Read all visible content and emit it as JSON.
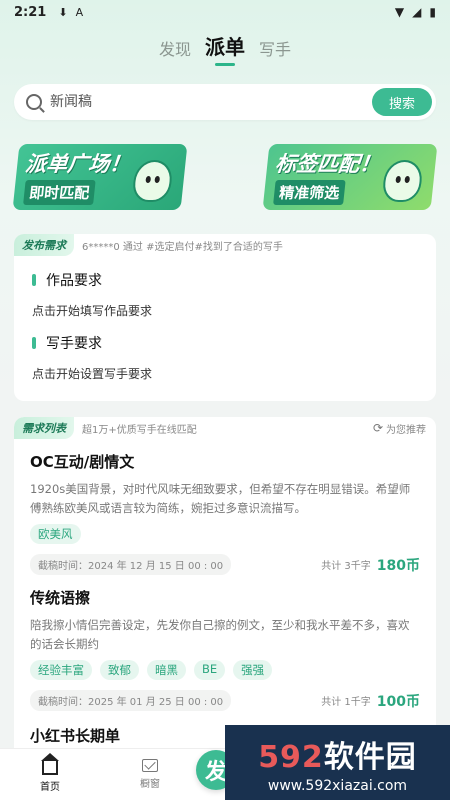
{
  "status_bar": {
    "time": "2:21",
    "download_icon": "download-icon",
    "a_icon": "A"
  },
  "top_tabs": [
    {
      "label": "发现",
      "active": false
    },
    {
      "label": "派单",
      "active": true
    },
    {
      "label": "写手",
      "active": false
    }
  ],
  "search": {
    "placeholder": "新闻稿",
    "button_label": "搜索"
  },
  "banners": [
    {
      "title": "派单广场！",
      "subtitle": "即时匹配"
    },
    {
      "title": "标签匹配！",
      "subtitle": "精准筛选"
    }
  ],
  "publish_card": {
    "tag": "发布需求",
    "note": "6*****0 通过 #选定启付#找到了合适的写手",
    "items": [
      {
        "title": "作品要求",
        "sub": "点击开始填写作品要求"
      },
      {
        "title": "写手要求",
        "sub": "点击开始设置写手要求"
      }
    ]
  },
  "list_card": {
    "tag": "需求列表",
    "note": "超1万+优质写手在线匹配",
    "refresh_label": "为您推荐",
    "posts": [
      {
        "title": "OC互动/剧情文",
        "desc": "1920s美国背景，对时代风味无细致要求，但希望不存在明显错误。希望师傅熟练欧美风或语言较为简练，婉拒过多意识流描写。",
        "tags": [
          "欧美风"
        ],
        "deadline": "截稿时间：2024 年 12 月 15 日 00 : 00",
        "words": "共计 3千字",
        "price": "180币"
      },
      {
        "title": "传统语擦",
        "desc": "陪我擦小情侣完善设定，先发你自己擦的例文，至少和我水平差不多，喜欢的话会长期约",
        "tags": [
          "经验丰富",
          "致郁",
          "暗黑",
          "BE",
          "强强"
        ],
        "deadline": "截稿时间：2025 年 01 月 25 日 00 : 00",
        "words": "共计 1千字",
        "price": "100币"
      },
      {
        "title": "小红书长期单"
      }
    ]
  },
  "bottom_nav": [
    {
      "label": "首页",
      "icon": "home-icon"
    },
    {
      "label": "橱窗",
      "icon": "mail-icon"
    }
  ],
  "fab": {
    "label": "发"
  },
  "watermark": {
    "logo_num": "592",
    "logo_text": "软件园",
    "url": "www.592xiazai.com"
  }
}
